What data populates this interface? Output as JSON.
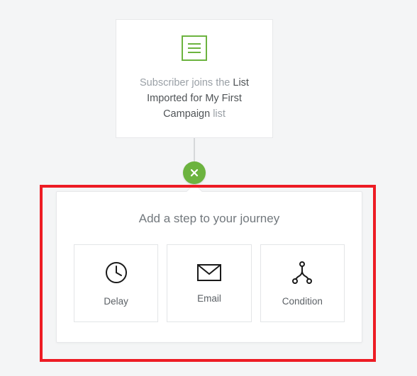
{
  "trigger": {
    "prefix": "Subscriber joins the ",
    "list_name": "List Imported for My First Campaign",
    "suffix": " list",
    "icon_name": "list-icon"
  },
  "close_button": {
    "icon_name": "close-icon"
  },
  "step_panel": {
    "title": "Add a step to your journey",
    "options": [
      {
        "label": "Delay",
        "icon": "clock-icon"
      },
      {
        "label": "Email",
        "icon": "envelope-icon"
      },
      {
        "label": "Condition",
        "icon": "branch-icon"
      }
    ]
  },
  "colors": {
    "accent": "#6cb33f",
    "highlight": "#ed1c24"
  }
}
